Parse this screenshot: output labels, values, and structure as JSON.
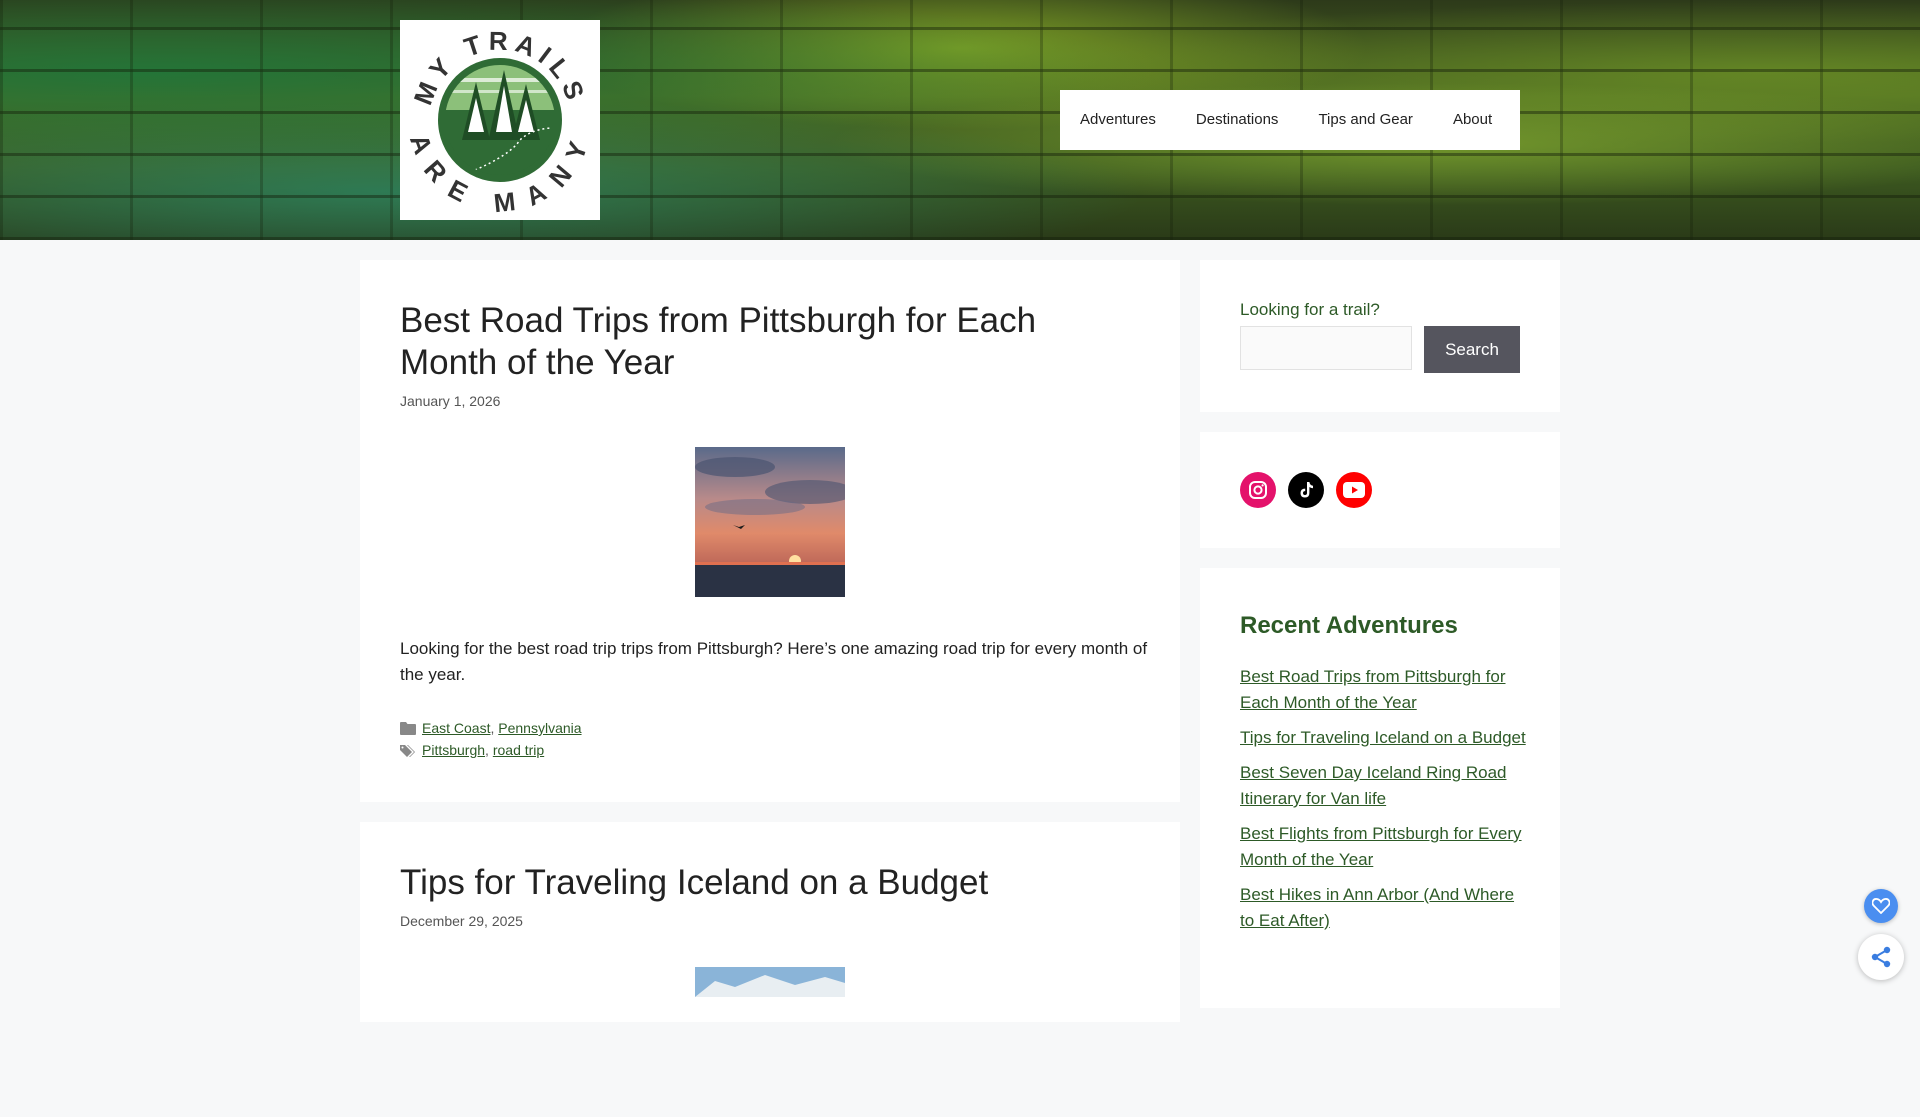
{
  "site": {
    "logo_top_text": "MY TRAILS",
    "logo_bottom_text": "ARE MANY"
  },
  "nav": {
    "items": [
      "Adventures",
      "Destinations",
      "Tips and Gear",
      "About"
    ]
  },
  "posts": [
    {
      "title": "Best Road Trips from Pittsburgh for Each Month of the Year",
      "date": "January 1, 2026",
      "excerpt": "Looking for the best road trip trips from Pittsburgh? Here’s one amazing road trip for every month of the year.",
      "categories": [
        "East Coast",
        "Pennsylvania"
      ],
      "tags": [
        "Pittsburgh",
        "road trip"
      ]
    },
    {
      "title": "Tips for Traveling Iceland on a Budget",
      "date": "December 29, 2025"
    }
  ],
  "sidebar": {
    "search_label": "Looking for a trail?",
    "search_button": "Search",
    "social_icons": [
      "instagram-icon",
      "tiktok-icon",
      "youtube-icon"
    ],
    "recent_title": "Recent Adventures",
    "recent_items": [
      "Best Road Trips from Pittsburgh for Each Month of the Year",
      "Tips for Traveling Iceland on a Budget",
      "Best Seven Day Iceland Ring Road Itinerary for Van life",
      "Best Flights from Pittsburgh for Every Month of the Year",
      "Best Hikes in Ann Arbor (And Where to Eat After)"
    ]
  },
  "colors": {
    "accent": "#2d5a27",
    "search_button": "#55555e",
    "instagram": "#e4126b",
    "tiktok": "#000000",
    "youtube": "#ff0000",
    "fab": "#4a8ef0"
  }
}
